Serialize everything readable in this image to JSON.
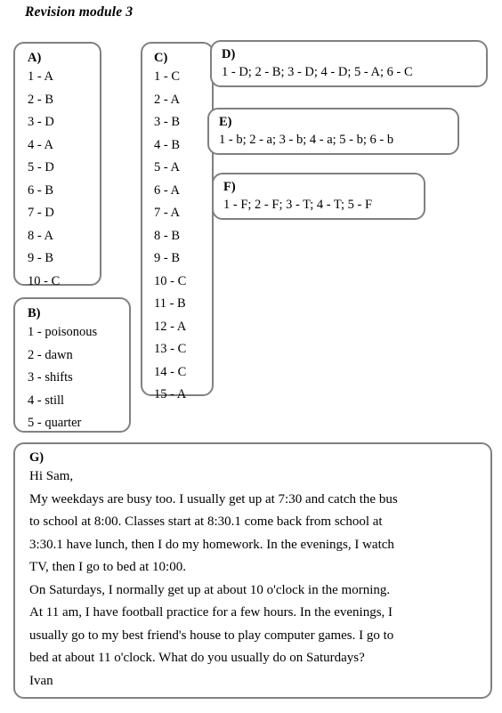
{
  "document": {
    "title": "Revision module 3"
  },
  "sections": {
    "a": {
      "label": "A)",
      "answers": [
        "1 - A",
        "2 - B",
        "3 - D",
        "4 - A",
        "5 - D",
        "6 - B",
        "7 - D",
        "8 - A",
        "9 - B",
        "10 - C"
      ]
    },
    "b": {
      "label": "B)",
      "answers": [
        "1 - poisonous",
        "2 - dawn",
        "3 - shifts",
        "4 - still",
        "5 - quarter"
      ]
    },
    "c": {
      "label": "C)",
      "answers": [
        "1 - C",
        "2 - A",
        "3 - B",
        "4 - B",
        "5 - A",
        "6 - A",
        "7 - A",
        "8 - B",
        "9 - B",
        "10 - C",
        "11 - B",
        "12 - A",
        "13 - C",
        "14 - C",
        "15 - A"
      ]
    },
    "d": {
      "label": "D)",
      "answers": "1 - D; 2 - B; 3 - D; 4 - D; 5 - A; 6 - C"
    },
    "e": {
      "label": "E)",
      "answers": "1 - b; 2 - a; 3 - b; 4 - a; 5 - b; 6 - b"
    },
    "f": {
      "label": "F)",
      "answers": "1 - F; 2 - F; 3 - T; 4 - T; 5 - F"
    },
    "g": {
      "label": "G)",
      "lines": [
        "Hi Sam,",
        "My weekdays are busy too. I usually get up at 7:30 and catch the bus",
        "to school at 8:00. Classes start at 8:30.1 come back from school at",
        "3:30.1 have lunch, then I do my homework. In the evenings, I watch",
        "TV, then I go to bed at 10:00.",
        "On Saturdays, I normally get up at about 10 o'clock in the morning.",
        "At 11 am, I have football practice for a few hours. In the evenings, I",
        "usually go to my best friend's house to play computer games. I go to",
        "bed at about 11 o'clock. What do you usually do on Saturdays?",
        "Ivan"
      ]
    }
  },
  "colors": {
    "border": "#808080",
    "text": "#000000",
    "background": "#ffffff"
  }
}
